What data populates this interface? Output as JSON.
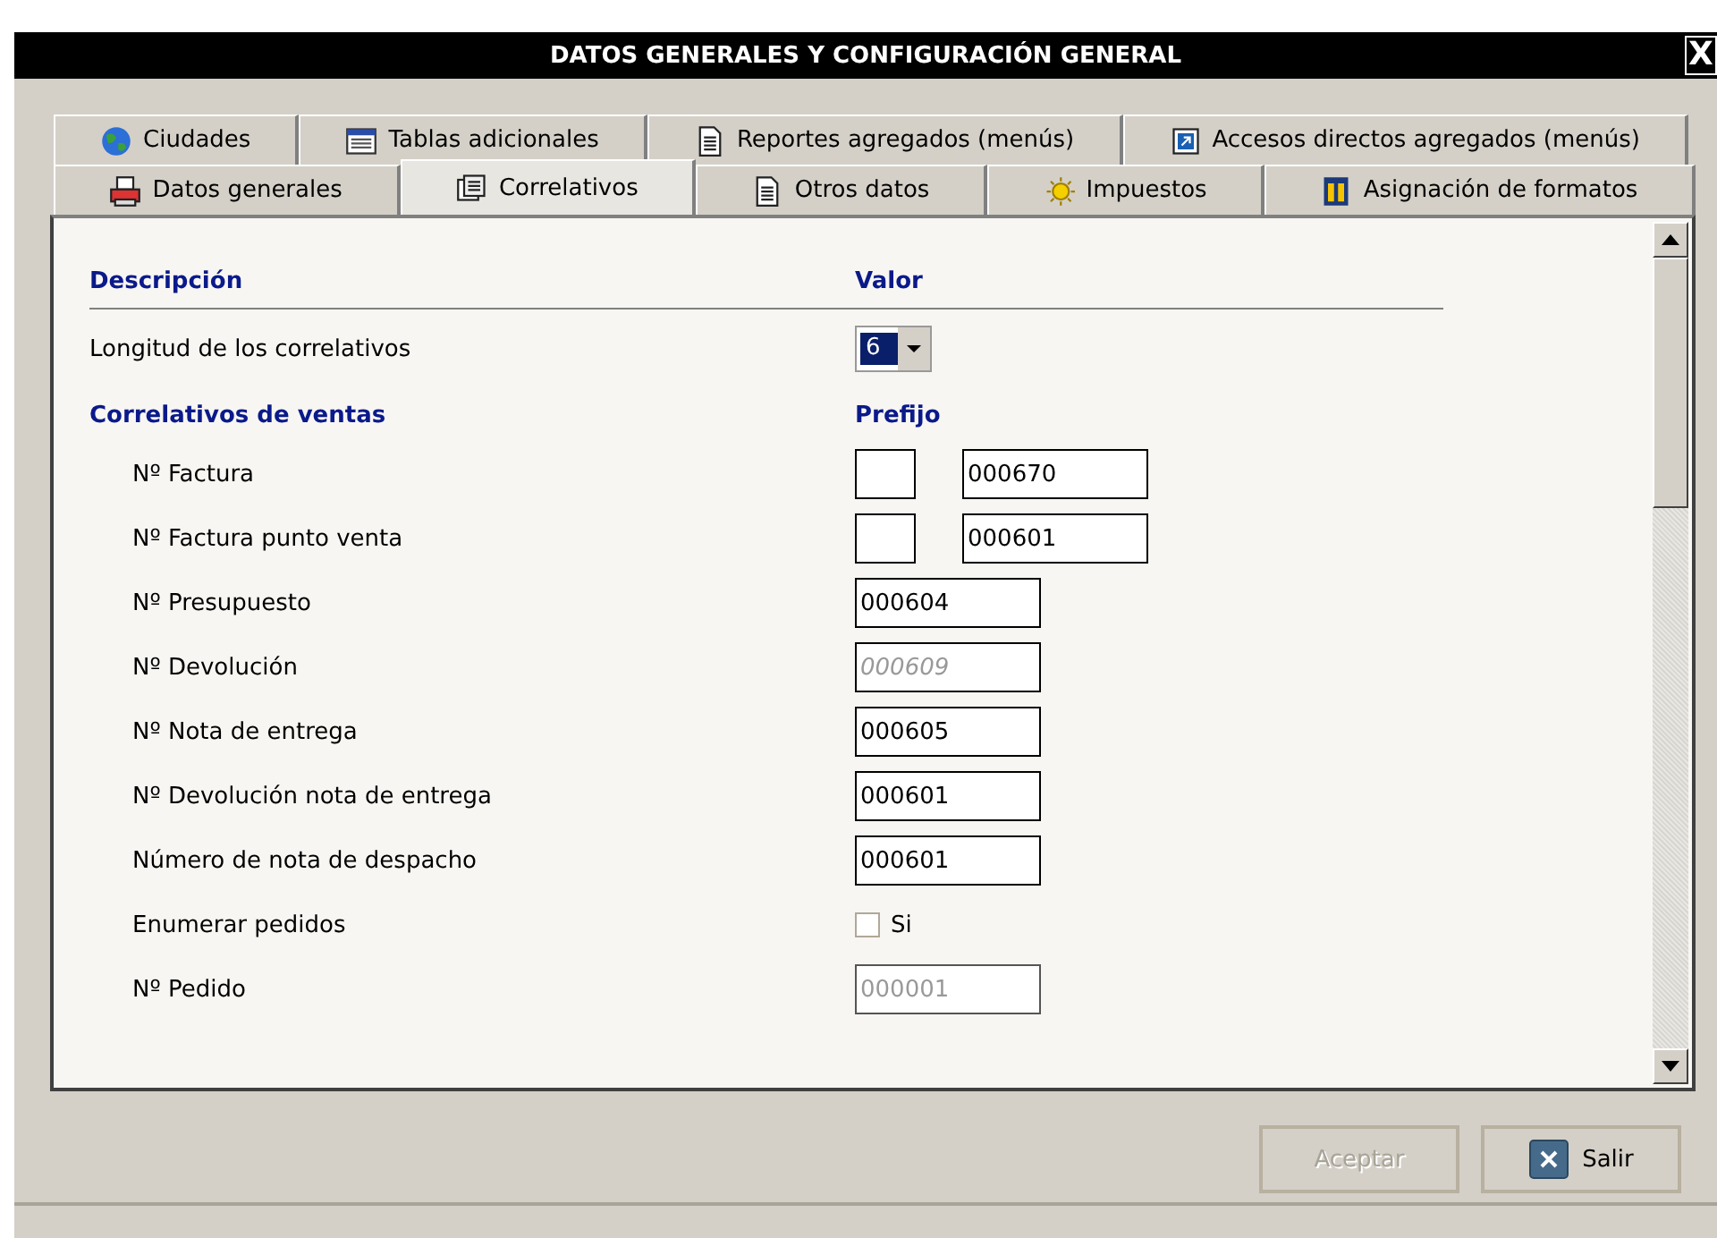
{
  "window": {
    "title": "DATOS GENERALES Y CONFIGURACIÓN GENERAL",
    "close": "X"
  },
  "tab_rows": [
    [
      {
        "label": "Ciudades",
        "selected": false
      },
      {
        "label": "Tablas adicionales",
        "selected": false
      },
      {
        "label": "Reportes agregados (menús)",
        "selected": false
      },
      {
        "label": "Accesos directos agregados (menús)",
        "selected": false
      }
    ],
    [
      {
        "label": "Datos generales",
        "selected": false
      },
      {
        "label": "Correlativos",
        "selected": true
      },
      {
        "label": "Otros datos",
        "selected": false
      },
      {
        "label": "Impuestos",
        "selected": false
      },
      {
        "label": "Asignación de formatos",
        "selected": false
      }
    ]
  ],
  "rows": [
    {
      "kind": "header",
      "label": "Descripción",
      "value": "Valor"
    },
    {
      "kind": "select",
      "label": "Longitud de los correlativos",
      "value": "6"
    },
    {
      "kind": "section",
      "label": "Correlativos de ventas",
      "value": "Prefijo"
    },
    {
      "kind": "prefixed",
      "label": "Nº Factura",
      "value": "000670"
    },
    {
      "kind": "prefixed",
      "label": "Nº Factura punto venta",
      "value": "000601"
    },
    {
      "kind": "field",
      "label": "Nº Presupuesto",
      "value": "000604",
      "disabled": false
    },
    {
      "kind": "field",
      "label": "Nº Devolución",
      "placeholder": "000609",
      "disabled": false
    },
    {
      "kind": "field",
      "label": "Nº Nota de entrega",
      "value": "000605",
      "disabled": false
    },
    {
      "kind": "field",
      "label": "Nº Devolución nota de entrega",
      "value": "000601",
      "disabled": false
    },
    {
      "kind": "field",
      "label": "Número de nota de despacho",
      "value": "000601",
      "disabled": false
    },
    {
      "kind": "checkbox",
      "label": "Enumerar pedidos",
      "value": "Si",
      "checked": false
    },
    {
      "kind": "field",
      "label": "Nº Pedido",
      "value": "000001",
      "disabled": true
    }
  ],
  "buttons": [
    {
      "label": "Aceptar",
      "disabled": true
    },
    {
      "label": "Salir",
      "disabled": false
    }
  ]
}
